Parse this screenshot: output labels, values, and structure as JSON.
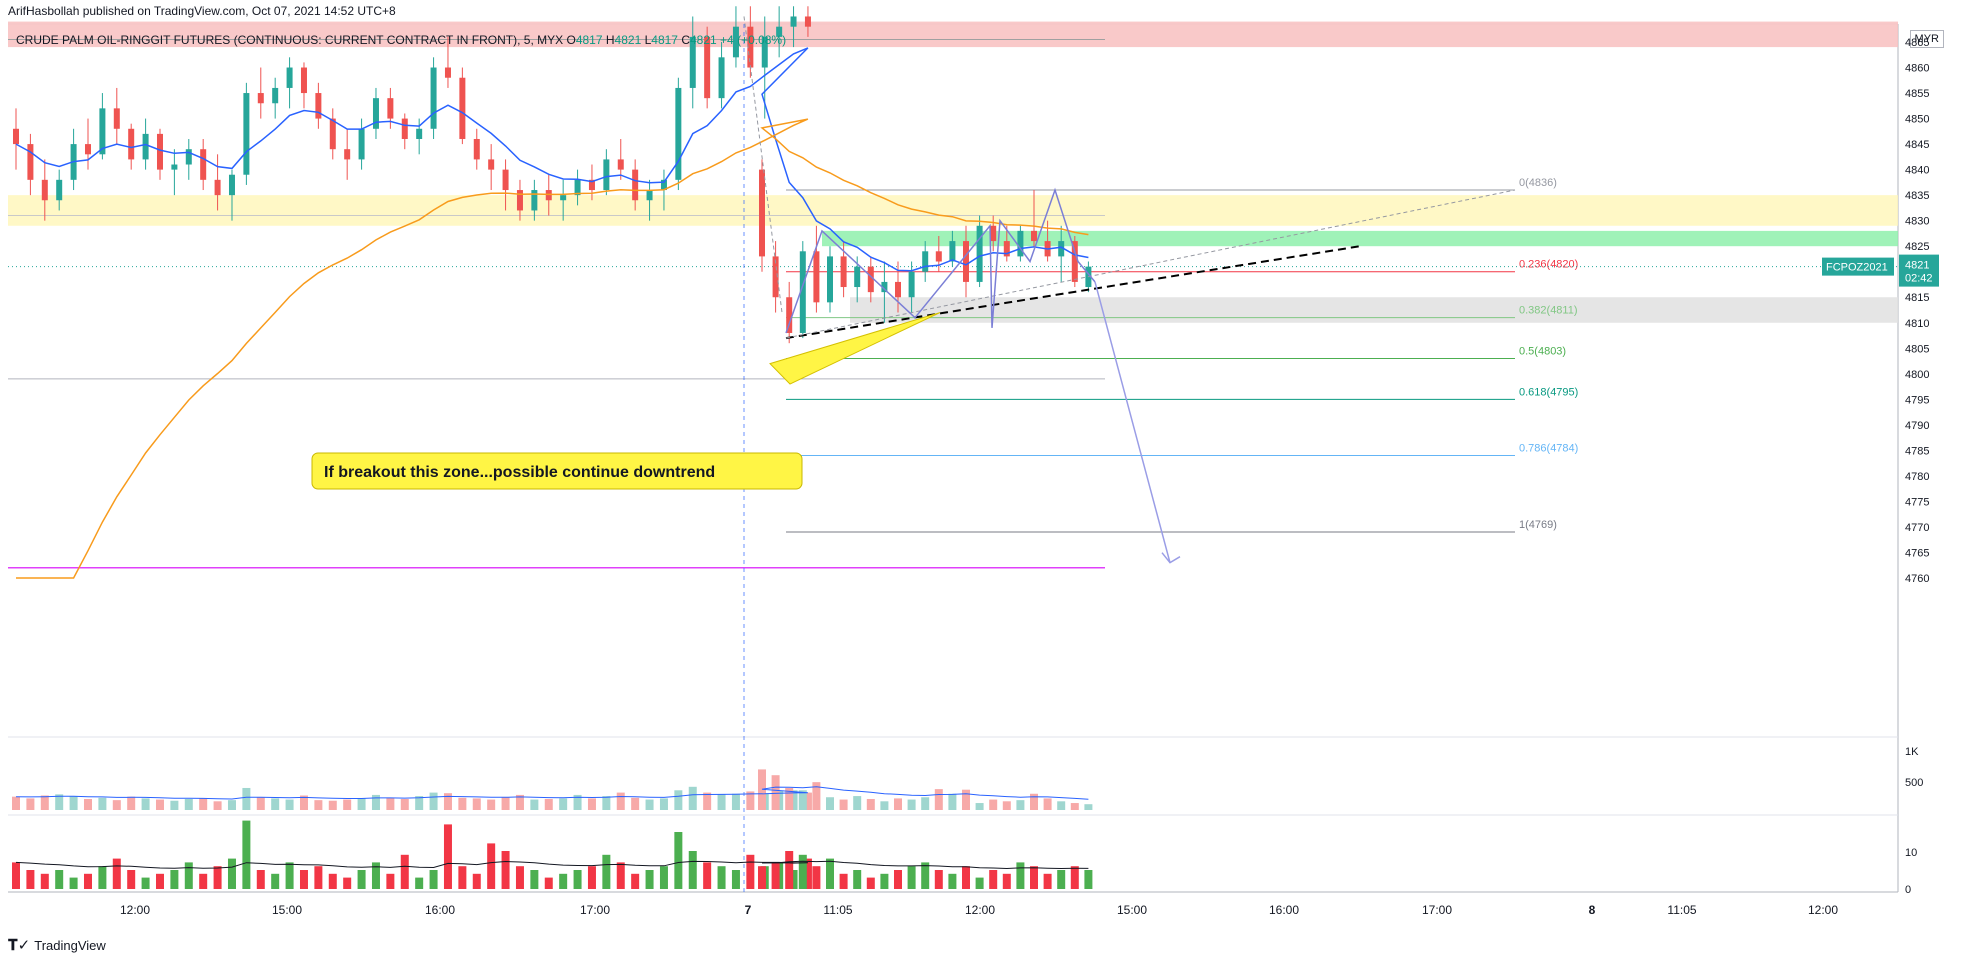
{
  "header": {
    "published": "ArifHasbollah published on TradingView.com, Oct 07, 2021 14:52 UTC+8"
  },
  "symbol": {
    "name": "CRUDE PALM OIL-RINGGIT FUTURES (CONTINUOUS: CURRENT CONTRACT IN FRONT), 5, MYX",
    "o_label": "O",
    "o": "4817",
    "h_label": "H",
    "h": "4821",
    "l_label": "L",
    "l": "4817",
    "c_label": "C",
    "c": "4821",
    "change": "+4 (+0.08%)"
  },
  "currency": "MYR",
  "price_tag": {
    "ticker": "FCPOZ2021",
    "price": "4821",
    "countdown": "02:42"
  },
  "annotation": "If breakout this zone...possible continue downtrend",
  "footer": {
    "brand": "TradingView"
  },
  "colors": {
    "up": "#26a69a",
    "down": "#ef5350",
    "ema_short": "#2962ff",
    "ema_long": "#f89b1c",
    "zone_red": "#f8bfc0",
    "zone_yellow": "#fff6b8",
    "zone_green": "#8ef0ab",
    "zone_grey": "#e1e1e1",
    "magenta": "#e040fb",
    "annotation_bg": "#fff545"
  },
  "chart_data": {
    "type": "candlestick",
    "price_axis": {
      "ticks": [
        4760,
        4765,
        4770,
        4775,
        4780,
        4785,
        4790,
        4795,
        4800,
        4805,
        4810,
        4815,
        4820,
        4825,
        4830,
        4835,
        4840,
        4845,
        4850,
        4855,
        4860,
        4865
      ],
      "labels": [
        "4760",
        "4765",
        "4770",
        "4775",
        "4780",
        "4785",
        "4790",
        "4795",
        "4800",
        "4805",
        "4810",
        "4815",
        "4820",
        "4825",
        "4830",
        "4835",
        "4840",
        "4845",
        "4850",
        "4855",
        "4860",
        "4865"
      ]
    },
    "time_axis": {
      "labels": [
        "12:00",
        "15:00",
        "16:00",
        "17:00",
        "7",
        "11:05",
        "12:00",
        "15:00",
        "16:00",
        "17:00",
        "8",
        "11:05",
        "12:00"
      ]
    },
    "volume_axis": {
      "labels": [
        "1K",
        "500"
      ]
    },
    "osc_axis": {
      "labels": [
        "10",
        "0"
      ]
    },
    "fib_levels": [
      {
        "label": "0(4836)",
        "price": 4836,
        "color": "#9598a1"
      },
      {
        "label": "0.236(4820)",
        "price": 4820,
        "color": "#f23645"
      },
      {
        "label": "0.382(4811)",
        "price": 4811,
        "color": "#81c784"
      },
      {
        "label": "0.5(4803)",
        "price": 4803,
        "color": "#4caf50"
      },
      {
        "label": "0.618(4795)",
        "price": 4795,
        "color": "#089981"
      },
      {
        "label": "0.786(4784)",
        "price": 4784,
        "color": "#64b5f6"
      },
      {
        "label": "1(4769)",
        "price": 4769,
        "color": "#787b86"
      }
    ],
    "zones": [
      {
        "name": "red",
        "from": 4864,
        "to": 4869
      },
      {
        "name": "yellow",
        "from": 4829,
        "to": 4835
      },
      {
        "name": "green",
        "from": 4825,
        "to": 4828
      },
      {
        "name": "grey",
        "from": 4810,
        "to": 4815
      }
    ],
    "candles_day1": [
      [
        4848,
        4852,
        4840,
        4845
      ],
      [
        4845,
        4847,
        4835,
        4838
      ],
      [
        4838,
        4842,
        4830,
        4834
      ],
      [
        4834,
        4840,
        4832,
        4838
      ],
      [
        4838,
        4848,
        4836,
        4845
      ],
      [
        4845,
        4850,
        4840,
        4843
      ],
      [
        4843,
        4855,
        4842,
        4852
      ],
      [
        4852,
        4856,
        4845,
        4848
      ],
      [
        4848,
        4849,
        4840,
        4842
      ],
      [
        4842,
        4850,
        4840,
        4847
      ],
      [
        4847,
        4848,
        4838,
        4840
      ],
      [
        4840,
        4844,
        4835,
        4841
      ],
      [
        4841,
        4846,
        4838,
        4844
      ],
      [
        4844,
        4846,
        4836,
        4838
      ],
      [
        4838,
        4843,
        4832,
        4835
      ],
      [
        4835,
        4840,
        4830,
        4839
      ],
      [
        4839,
        4857,
        4837,
        4855
      ],
      [
        4855,
        4860,
        4850,
        4853
      ],
      [
        4853,
        4858,
        4850,
        4856
      ],
      [
        4856,
        4862,
        4852,
        4860
      ],
      [
        4860,
        4861,
        4852,
        4855
      ],
      [
        4855,
        4857,
        4848,
        4850
      ],
      [
        4850,
        4852,
        4842,
        4844
      ],
      [
        4844,
        4848,
        4838,
        4842
      ],
      [
        4842,
        4850,
        4840,
        4848
      ],
      [
        4848,
        4856,
        4846,
        4854
      ],
      [
        4854,
        4856,
        4848,
        4850
      ],
      [
        4850,
        4851,
        4844,
        4846
      ],
      [
        4846,
        4850,
        4843,
        4848
      ],
      [
        4848,
        4862,
        4846,
        4860
      ],
      [
        4860,
        4866,
        4856,
        4858
      ],
      [
        4858,
        4860,
        4845,
        4846
      ],
      [
        4846,
        4848,
        4840,
        4842
      ],
      [
        4842,
        4845,
        4836,
        4840
      ],
      [
        4840,
        4842,
        4832,
        4836
      ],
      [
        4836,
        4838,
        4830,
        4832
      ],
      [
        4832,
        4838,
        4830,
        4836
      ],
      [
        4836,
        4839,
        4831,
        4834
      ],
      [
        4834,
        4838,
        4830,
        4835
      ],
      [
        4835,
        4840,
        4833,
        4838
      ],
      [
        4838,
        4841,
        4834,
        4836
      ],
      [
        4836,
        4844,
        4835,
        4842
      ],
      [
        4842,
        4846,
        4838,
        4840
      ],
      [
        4840,
        4842,
        4832,
        4834
      ],
      [
        4834,
        4838,
        4830,
        4836
      ],
      [
        4836,
        4840,
        4832,
        4838
      ],
      [
        4838,
        4858,
        4836,
        4856
      ],
      [
        4856,
        4870,
        4852,
        4866
      ],
      [
        4866,
        4868,
        4852,
        4854
      ],
      [
        4854,
        4865,
        4852,
        4862
      ],
      [
        4862,
        4872,
        4860,
        4868
      ],
      [
        4868,
        4872,
        4858,
        4860
      ],
      [
        4860,
        4870,
        4850,
        4866
      ],
      [
        4866,
        4872,
        4862,
        4868
      ],
      [
        4868,
        4872,
        4864,
        4870
      ],
      [
        4870,
        4872,
        4866,
        4868
      ]
    ],
    "candles_day2": [
      [
        4840,
        4842,
        4820,
        4823
      ],
      [
        4823,
        4826,
        4812,
        4815
      ],
      [
        4815,
        4818,
        4806,
        4808
      ],
      [
        4808,
        4826,
        4807,
        4824
      ],
      [
        4824,
        4829,
        4812,
        4814
      ],
      [
        4814,
        4825,
        4812,
        4823
      ],
      [
        4823,
        4826,
        4815,
        4817
      ],
      [
        4817,
        4823,
        4814,
        4821
      ],
      [
        4821,
        4823,
        4814,
        4816
      ],
      [
        4816,
        4822,
        4810,
        4818
      ],
      [
        4818,
        4822,
        4812,
        4815
      ],
      [
        4815,
        4822,
        4812,
        4820
      ],
      [
        4820,
        4826,
        4818,
        4824
      ],
      [
        4824,
        4827,
        4820,
        4822
      ],
      [
        4822,
        4828,
        4821,
        4826
      ],
      [
        4826,
        4829,
        4815,
        4818
      ],
      [
        4818,
        4831,
        4817,
        4829
      ],
      [
        4829,
        4831,
        4824,
        4826
      ],
      [
        4826,
        4829,
        4822,
        4823
      ],
      [
        4823,
        4829,
        4822,
        4828
      ],
      [
        4828,
        4836,
        4825,
        4826
      ],
      [
        4826,
        4830,
        4822,
        4823
      ],
      [
        4823,
        4829,
        4818,
        4826
      ],
      [
        4826,
        4827,
        4817,
        4818
      ],
      [
        4817,
        4822,
        4816,
        4821
      ]
    ],
    "volume_day1": [
      230,
      200,
      250,
      270,
      240,
      190,
      210,
      170,
      230,
      200,
      180,
      160,
      190,
      200,
      150,
      170,
      380,
      220,
      200,
      180,
      250,
      170,
      160,
      180,
      200,
      260,
      210,
      190,
      240,
      300,
      290,
      210,
      200,
      180,
      220,
      260,
      180,
      190,
      200,
      260,
      200,
      240,
      300,
      210,
      180,
      200,
      340,
      400,
      300,
      270,
      280,
      320,
      290,
      330,
      340,
      300
    ],
    "volume_day2": [
      700,
      600,
      380,
      340,
      480,
      220,
      180,
      240,
      190,
      150,
      200,
      180,
      220,
      360,
      280,
      350,
      120,
      180,
      150,
      170,
      280,
      200,
      150,
      120,
      100
    ],
    "osc_day1": [
      7,
      5,
      4,
      5,
      3,
      4,
      6,
      8,
      5,
      3,
      4,
      5,
      7,
      4,
      6,
      8,
      18,
      5,
      4,
      7,
      5,
      6,
      4,
      3,
      5,
      7,
      4,
      9,
      3,
      5,
      17,
      6,
      4,
      12,
      10,
      6,
      5,
      3,
      4,
      5,
      6,
      9,
      7,
      4,
      5,
      6,
      15,
      10,
      7,
      6,
      5,
      9,
      6,
      7,
      5,
      8
    ],
    "osc_day2": [
      6,
      7,
      10,
      9,
      6,
      8,
      4,
      5,
      3,
      4,
      5,
      6,
      7,
      5,
      4,
      6,
      3,
      5,
      4,
      7,
      6,
      4,
      5,
      6,
      5
    ]
  }
}
